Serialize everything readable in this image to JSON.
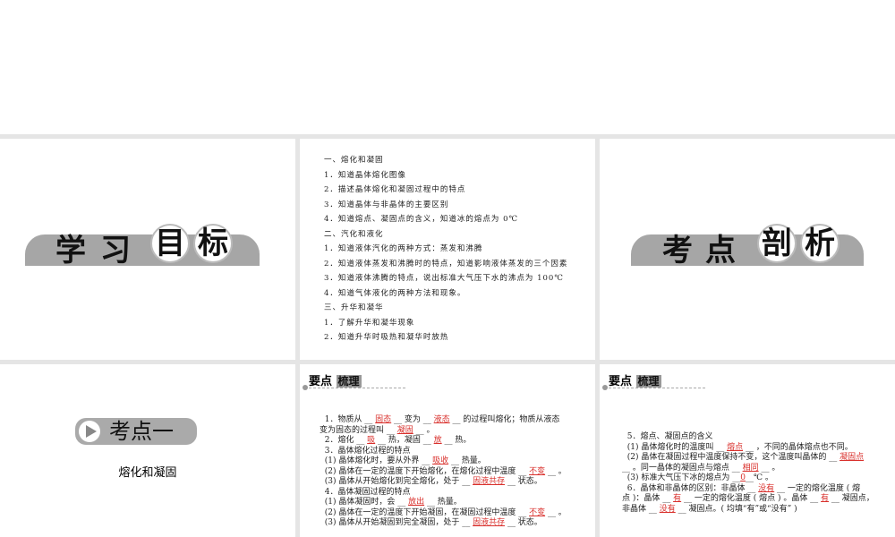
{
  "slide1": {
    "chars": [
      "学",
      "习",
      "目",
      "标"
    ]
  },
  "slide2": {
    "lines": [
      "一、熔化和凝固",
      "1．知道晶体熔化图像",
      "2．描述晶体熔化和凝固过程中的特点",
      "3．知道晶体与非晶体的主要区别",
      "4．知道熔点、凝固点的含义，知道冰的熔点为 0℃",
      "二、汽化和液化",
      "1．知道液体汽化的两种方式：蒸发和沸腾",
      "2．知道液体蒸发和沸腾时的特点，知道影响液体蒸发的三个因素",
      "3．知道液体沸腾的特点，说出标准大气压下水的沸点为 100℃",
      "4．知道气体液化的两种方法和现象。",
      "三、升华和凝华",
      "1．了解升华和凝华现象",
      "2．知道升华时吸热和凝华时放热"
    ]
  },
  "slide3": {
    "chars": [
      "考",
      "点",
      "剖",
      "析"
    ]
  },
  "slide4": {
    "badge": "考点一",
    "subtitle": "熔化和凝固"
  },
  "slide5": {
    "heading": "要点",
    "heading_box": "梳理",
    "lines": [
      [
        {
          "t": "  1．物质从 __ "
        },
        {
          "a": "固态"
        },
        {
          "t": " __ 变为 __ "
        },
        {
          "a": "液态"
        },
        {
          "t": " __ 的过程叫熔化；物质从液态"
        }
      ],
      [
        {
          "t": "变为固态的过程叫 __ "
        },
        {
          "a": "凝固"
        },
        {
          "t": " __ 。"
        }
      ],
      [
        {
          "t": "  2．熔化 __ "
        },
        {
          "a": "吸"
        },
        {
          "t": " __ 热，凝固 __ "
        },
        {
          "a": "放"
        },
        {
          "t": " __ 热。"
        }
      ],
      [
        {
          "t": "  3．晶体熔化过程的特点"
        }
      ],
      [
        {
          "t": "  (1) 晶体熔化时，要从外界 __ "
        },
        {
          "a": "吸收"
        },
        {
          "t": " __ 热量。"
        }
      ],
      [
        {
          "t": "  (2) 晶体在一定的温度下开始熔化，在熔化过程中温度 __ "
        },
        {
          "a": "不变"
        },
        {
          "t": " __ 。"
        }
      ],
      [
        {
          "t": "  (3) 晶体从开始熔化到完全熔化，处于 __ "
        },
        {
          "a": "固液共存"
        },
        {
          "t": " __ 状态。"
        }
      ],
      [
        {
          "t": "  4．晶体凝固过程的特点"
        }
      ],
      [
        {
          "t": "  (1) 晶体凝固时，会 __ "
        },
        {
          "a": "放出"
        },
        {
          "t": " __ 热量。"
        }
      ],
      [
        {
          "t": "  (2) 晶体在一定的温度下开始凝固，在凝固过程中温度 __ "
        },
        {
          "a": "不变"
        },
        {
          "t": " __ 。"
        }
      ],
      [
        {
          "t": "  (3) 晶体从开始凝固到完全凝固，处于 __ "
        },
        {
          "a": "固液共存"
        },
        {
          "t": " __ 状态。"
        }
      ]
    ]
  },
  "slide6": {
    "heading": "要点",
    "heading_box": "梳理",
    "lines": [
      [
        {
          "t": "  5．熔点、凝固点的含义"
        }
      ],
      [
        {
          "t": "  (1) 晶体熔化时的温度叫 __ "
        },
        {
          "a": "熔点"
        },
        {
          "t": " __ ，不同的晶体熔点也不同。"
        }
      ],
      [
        {
          "t": "  (2) 晶体在凝固过程中温度保持不变，这个温度叫晶体的 __ "
        },
        {
          "a": "凝固点"
        }
      ],
      [
        {
          "t": "__ 。同一晶体的凝固点与熔点 __ "
        },
        {
          "a": "相同"
        },
        {
          "t": " __ 。"
        }
      ],
      [
        {
          "t": "  (3) 标准大气压下冰的熔点为 __"
        },
        {
          "a": "0"
        },
        {
          "t": "__℃ 。"
        }
      ],
      [
        {
          "t": "  6．晶体和非晶体的区别：非晶体 __ "
        },
        {
          "a": "没有"
        },
        {
          "t": " __ 一定的熔化温度 ( 熔"
        }
      ],
      [
        {
          "t": "点 )：晶体 __ "
        },
        {
          "a": "有"
        },
        {
          "t": " __ 一定的熔化温度 ( 熔点 ) 。晶体 __ "
        },
        {
          "a": "有"
        },
        {
          "t": " __ 凝固点，"
        }
      ],
      [
        {
          "t": "非晶体 __ "
        },
        {
          "a": "没有"
        },
        {
          "t": " __ 凝固点。( 均填“有”或“没有” )"
        }
      ]
    ]
  }
}
